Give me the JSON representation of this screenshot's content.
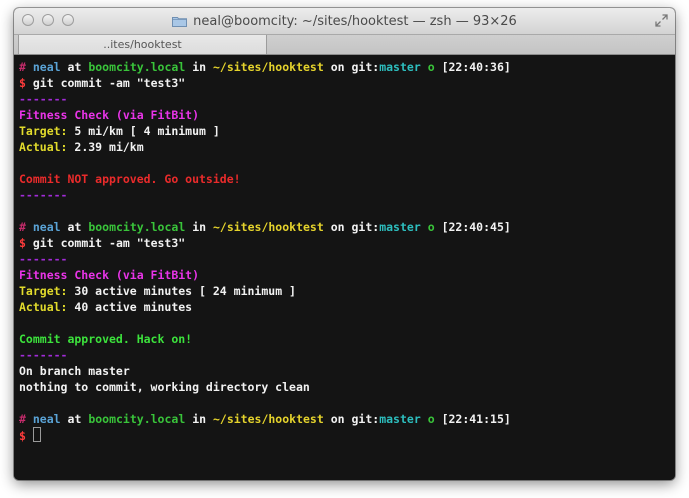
{
  "window": {
    "title": "neal@boomcity: ~/sites/hooktest — zsh — 93×26",
    "tab_label": "..ites/hooktest"
  },
  "prompt": {
    "hash": "#",
    "user": "neal",
    "at": "at",
    "host": "boomcity.local",
    "in": "in",
    "dir": "~/sites/hooktest",
    "on": "on",
    "git_label": "git:",
    "branch": "master",
    "status": "o",
    "dollar": "$"
  },
  "blocks": [
    {
      "time": "[22:40:36]",
      "command": "git commit -am \"test3\"",
      "separator": "-------",
      "heading": "Fitness Check (via FitBit)",
      "target_label": "Target:",
      "target_value": "5 mi/km [ 4 minimum ]",
      "actual_label": "Actual:",
      "actual_value": "2.39 mi/km",
      "result": "Commit NOT approved. Go outside!",
      "separator_end": "-------"
    },
    {
      "time": "[22:40:45]",
      "command": "git commit -am \"test3\"",
      "separator": "-------",
      "heading": "Fitness Check (via FitBit)",
      "target_label": "Target:",
      "target_value": "30 active minutes [ 24 minimum ]",
      "actual_label": "Actual:",
      "actual_value": "40 active minutes",
      "result": "Commit approved. Hack on!",
      "separator_end": "-------",
      "git_output": [
        "On branch master",
        "nothing to commit, working directory clean"
      ]
    }
  ],
  "final_prompt": {
    "time": "[22:41:15]"
  },
  "colors": {
    "background": "#141414",
    "hash": "#c42b6b",
    "user": "#5aa3d6",
    "host": "#39c43a",
    "dir": "#e5d32c",
    "branch": "#2dbfbf",
    "dollar": "#ff3c3c",
    "separator": "#a22bd8",
    "heading": "#e934e8",
    "label": "#e2db2c",
    "fail": "#ea2b2b",
    "pass": "#3ce23c"
  },
  "icons": [
    "folder-icon",
    "fullscreen-icon"
  ]
}
